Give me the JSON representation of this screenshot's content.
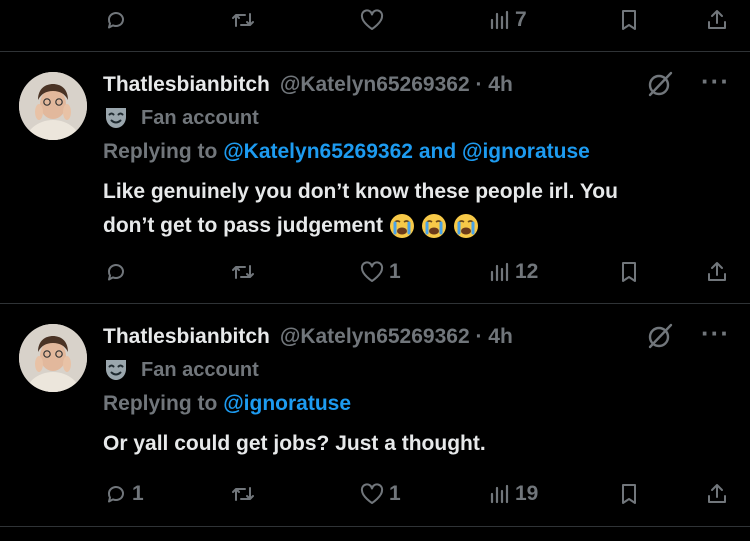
{
  "top_actions": {
    "reply_count": "",
    "retweet_count": "",
    "like_count": "",
    "views_count": "7"
  },
  "tweets": [
    {
      "display_name": "Thatlesbianbitch",
      "handle": "@Katelyn65269362 · 4h",
      "label": "Fan account",
      "replying_prefix": "Replying to",
      "replying_to_1": "@Katelyn65269362",
      "replying_joiner": "and",
      "replying_to_2": "@ignoratuse",
      "body_line1": "Like genuinely you don’t know these people irl. You",
      "body_line2": "don’t get to pass judgement",
      "emoji": "loudly-crying-face",
      "actions": {
        "reply_count": "",
        "retweet_count": "",
        "like_count": "1",
        "views_count": "12"
      }
    },
    {
      "display_name": "Thatlesbianbitch",
      "handle": "@Katelyn65269362 · 4h",
      "label": "Fan account",
      "replying_prefix": "Replying to",
      "replying_to_1": "@ignoratuse",
      "body_line1": "Or yall could get jobs? Just a thought.",
      "actions": {
        "reply_count": "1",
        "retweet_count": "",
        "like_count": "1",
        "views_count": "19"
      }
    }
  ],
  "colors": {
    "background": "#000000",
    "text": "#e7e9ea",
    "secondary": "#71767b",
    "link": "#1d9bf0",
    "divider": "#2f3336"
  },
  "icons": [
    "reply-icon",
    "retweet-icon",
    "like-icon",
    "views-icon",
    "bookmark-icon",
    "share-icon",
    "grok-icon",
    "more-icon",
    "theater-mask-icon"
  ]
}
